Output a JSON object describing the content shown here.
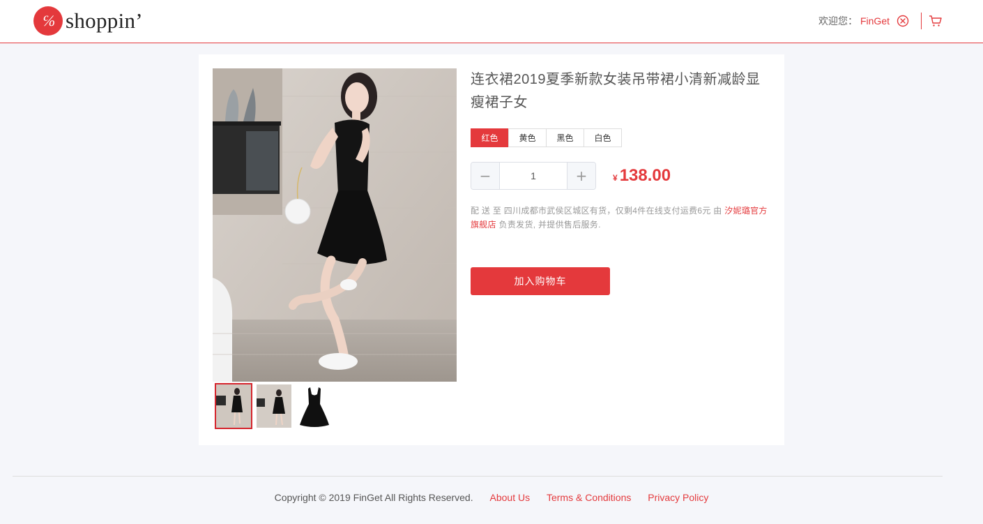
{
  "header": {
    "logo_mark": "℅",
    "logo_text": "shoppin’",
    "welcome_label": "欢迎您：",
    "username": "FinGet"
  },
  "product": {
    "title": "连衣裙2019夏季新款女装吊带裙小清新减龄显瘦裙子女",
    "colors": [
      {
        "label": "红色",
        "active": true
      },
      {
        "label": "黄色",
        "active": false
      },
      {
        "label": "黑色",
        "active": false
      },
      {
        "label": "白色",
        "active": false
      }
    ],
    "quantity": "1",
    "minus_label": "−",
    "plus_label": "+",
    "currency": "¥",
    "price": "138.00",
    "delivery_text": "配 送 至 四川成都市武侯区城区有货，仅剩4件在线支付运费6元 由 ",
    "store_name": "汐妮璐官方旗舰店",
    "delivery_suffix": " 负责发货, 并提供售后服务.",
    "add_to_cart": "加入购物车"
  },
  "footer": {
    "copyright": "Copyright © 2019 FinGet All Rights Reserved.",
    "links": [
      "About Us",
      "Terms & Conditions",
      "Privacy Policy"
    ]
  },
  "colors": {
    "accent": "#e4393c",
    "background": "#f5f6fa"
  },
  "icons": [
    "logout-icon",
    "cart-icon"
  ]
}
